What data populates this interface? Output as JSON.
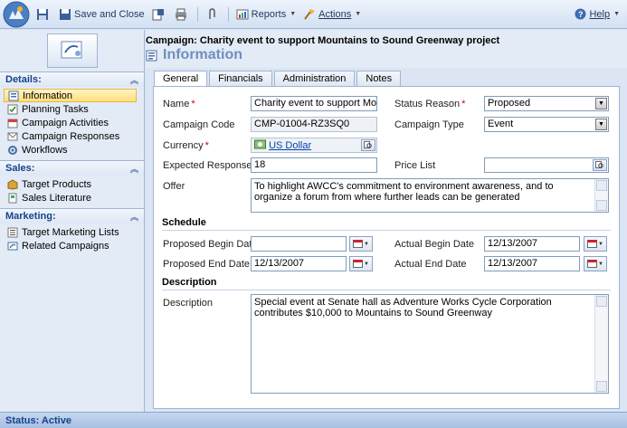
{
  "toolbar": {
    "save_and_close": "Save and Close",
    "reports": "Reports",
    "actions": "Actions",
    "help": "Help"
  },
  "nav": {
    "details": {
      "header": "Details:",
      "items": [
        "Information",
        "Planning Tasks",
        "Campaign Activities",
        "Campaign Responses",
        "Workflows"
      ]
    },
    "sales": {
      "header": "Sales:",
      "items": [
        "Target Products",
        "Sales Literature"
      ]
    },
    "marketing": {
      "header": "Marketing:",
      "items": [
        "Target Marketing Lists",
        "Related Campaigns"
      ]
    }
  },
  "header": {
    "title": "Campaign: Charity event to support Mountains to Sound Greenway project",
    "subtitle": "Information"
  },
  "tabs": [
    "General",
    "Financials",
    "Administration",
    "Notes"
  ],
  "form": {
    "name_label": "Name",
    "name_value": "Charity event to support Mountains to Sound Greenway project",
    "status_reason_label": "Status Reason",
    "status_reason_value": "Proposed",
    "campaign_code_label": "Campaign Code",
    "campaign_code_value": "CMP-01004-RZ3SQ0",
    "campaign_type_label": "Campaign Type",
    "campaign_type_value": "Event",
    "currency_label": "Currency",
    "currency_value": "US Dollar",
    "expected_response_label": "Expected Response",
    "expected_response_value": "18",
    "price_list_label": "Price List",
    "price_list_value": "",
    "offer_label": "Offer",
    "offer_value": "To highlight AWCC's commitment to environment awareness, and to organize a forum from where further leads can be generated",
    "schedule_heading": "Schedule",
    "proposed_begin_label": "Proposed Begin Date",
    "proposed_begin_value": "",
    "actual_begin_label": "Actual Begin Date",
    "actual_begin_value": "12/13/2007",
    "proposed_end_label": "Proposed End Date",
    "proposed_end_value": "12/13/2007",
    "actual_end_label": "Actual End Date",
    "actual_end_value": "12/13/2007",
    "description_heading": "Description",
    "description_label": "Description",
    "description_value": "Special event at Senate hall as Adventure Works Cycle Corporation contributes $10,000 to Mountains to Sound Greenway"
  },
  "status_bar": "Status: Active",
  "colors": {
    "accent": "#15428b",
    "selected_nav": "#ffdf7a",
    "required": "#d40000"
  }
}
